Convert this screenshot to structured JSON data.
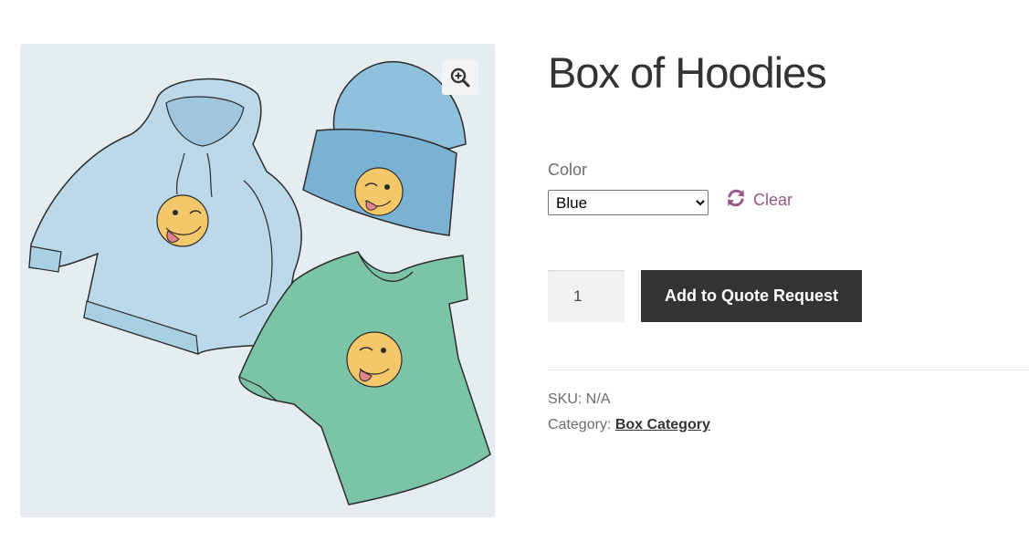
{
  "product": {
    "title": "Box of Hoodies",
    "image_icon": "product-image-hoodie-beanie-tshirt",
    "zoom_icon": "zoom-in-icon"
  },
  "variation": {
    "label": "Color",
    "selected": "Blue",
    "options": [
      "Blue"
    ],
    "clear_label": "Clear",
    "clear_icon": "refresh-icon"
  },
  "cart": {
    "quantity": "1",
    "button_label": "Add to Quote Request"
  },
  "meta": {
    "sku_label": "SKU:",
    "sku_value": "N/A",
    "category_label": "Category:",
    "category_value": "Box Category"
  },
  "colors": {
    "accent": "#96588a",
    "button_bg": "#333333",
    "title": "#333333",
    "text": "#6d6d6d",
    "image_bg": "#e6edf1"
  }
}
